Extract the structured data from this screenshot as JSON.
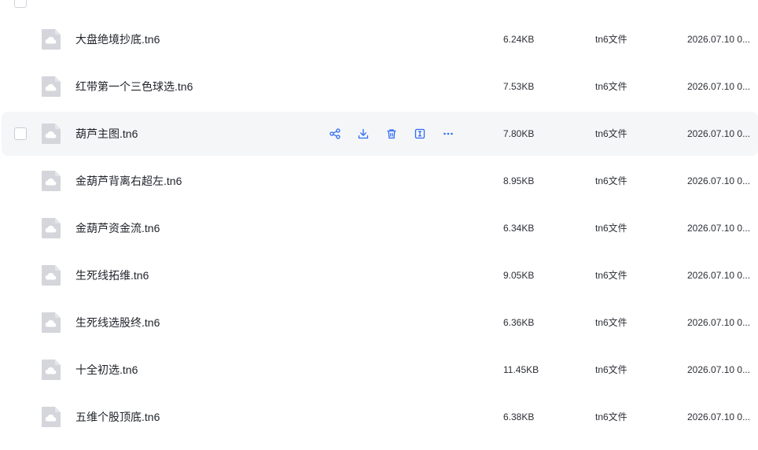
{
  "colors": {
    "accent": "#2f6bf6",
    "hover_row": "#f5f6f8",
    "icon_gray": "#d4d6db"
  },
  "actions": [
    {
      "name": "share-icon"
    },
    {
      "name": "download-icon"
    },
    {
      "name": "delete-icon"
    },
    {
      "name": "rename-icon"
    },
    {
      "name": "more-icon"
    }
  ],
  "files": [
    {
      "name": "大盘绝境抄底.tn6",
      "size": "6.24KB",
      "type": "tn6文件",
      "date": "2026.07.10 0..."
    },
    {
      "name": "红带第一个三色球选.tn6",
      "size": "7.53KB",
      "type": "tn6文件",
      "date": "2026.07.10 0..."
    },
    {
      "name": "葫芦主图.tn6",
      "size": "7.80KB",
      "type": "tn6文件",
      "date": "2026.07.10 0..."
    },
    {
      "name": "金葫芦背离右超左.tn6",
      "size": "8.95KB",
      "type": "tn6文件",
      "date": "2026.07.10 0..."
    },
    {
      "name": "金葫芦资金流.tn6",
      "size": "6.34KB",
      "type": "tn6文件",
      "date": "2026.07.10 0..."
    },
    {
      "name": "生死线拓维.tn6",
      "size": "9.05KB",
      "type": "tn6文件",
      "date": "2026.07.10 0..."
    },
    {
      "name": "生死线选股终.tn6",
      "size": "6.36KB",
      "type": "tn6文件",
      "date": "2026.07.10 0..."
    },
    {
      "name": "十全初选.tn6",
      "size": "11.45KB",
      "type": "tn6文件",
      "date": "2026.07.10 0..."
    },
    {
      "name": "五维个股顶底.tn6",
      "size": "6.38KB",
      "type": "tn6文件",
      "date": "2026.07.10 0..."
    }
  ],
  "hovered_index": 2
}
